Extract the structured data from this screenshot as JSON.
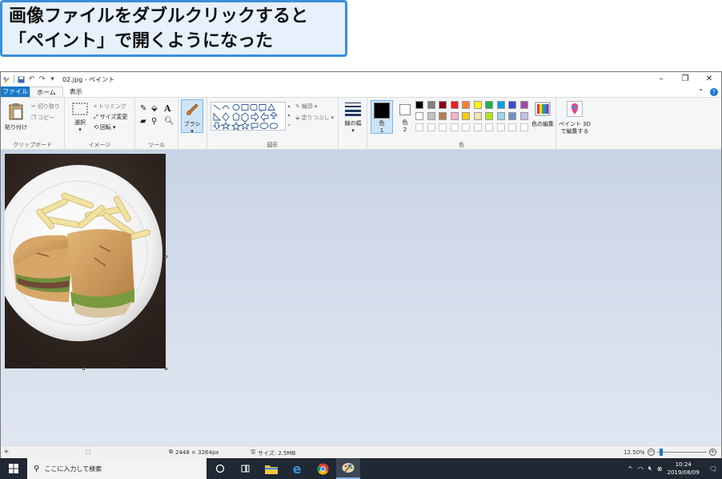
{
  "caption": {
    "line1": "画像ファイルをダブルクリックすると",
    "line2": "「ペイント」で開くようになった"
  },
  "window": {
    "title": "02.jpg - ペイント",
    "quick_access_icons": [
      "paint-app-icon",
      "save-icon",
      "undo-icon",
      "redo-icon",
      "customize-dropdown-icon"
    ],
    "controls": {
      "minimize": "–",
      "restore": "❐",
      "close": "✕"
    }
  },
  "tabs": {
    "file": "ファイル",
    "home": "ホーム",
    "view": "表示"
  },
  "ribbon": {
    "clipboard": {
      "paste": "貼り付け",
      "cut": "切り取り",
      "copy": "コピー",
      "label": "クリップボード"
    },
    "image": {
      "select": "選択",
      "crop": "トリミング",
      "resize": "サイズ変更",
      "rotate": "回転",
      "label": "イメージ"
    },
    "tools": {
      "label": "ツール"
    },
    "brushes": {
      "label": "ブラシ"
    },
    "shapes": {
      "outline": "輪郭",
      "fill": "塗りつぶし",
      "label": "図形"
    },
    "size": {
      "label": "線の幅"
    },
    "colors": {
      "color1": "色",
      "color1_num": "1",
      "color2": "色",
      "color2_num": "2",
      "edit": "色の編集",
      "label": "色",
      "color1_value": "#000000",
      "color2_value": "#ffffff",
      "palette_row1": [
        "#000000",
        "#7f7f7f",
        "#880015",
        "#ed1c24",
        "#ff7f27",
        "#fff200",
        "#22b14c",
        "#00a2e8",
        "#3f48cc",
        "#a349a4"
      ],
      "palette_row2": [
        "#ffffff",
        "#c3c3c3",
        "#b97a57",
        "#ffaec9",
        "#ffc90e",
        "#efe4b0",
        "#b5e61d",
        "#99d9ea",
        "#7092be",
        "#c8bfe7"
      ],
      "palette_row3_count": 10
    },
    "paint3d": {
      "label1": "ペイント 3D",
      "label2": "で編集する"
    }
  },
  "status": {
    "dimensions": "2448 × 3264px",
    "size": "サイズ: 2.5MB",
    "zoom": "12.50%",
    "zoom_level_fraction": 0.05
  },
  "taskbar": {
    "search_placeholder": "ここに入力して検索",
    "time": "10:24",
    "date": "2019/08/09",
    "apps": [
      "cortana-icon",
      "task-view-icon",
      "file-explorer-icon",
      "edge-icon",
      "chrome-icon",
      "paint-icon"
    ]
  }
}
